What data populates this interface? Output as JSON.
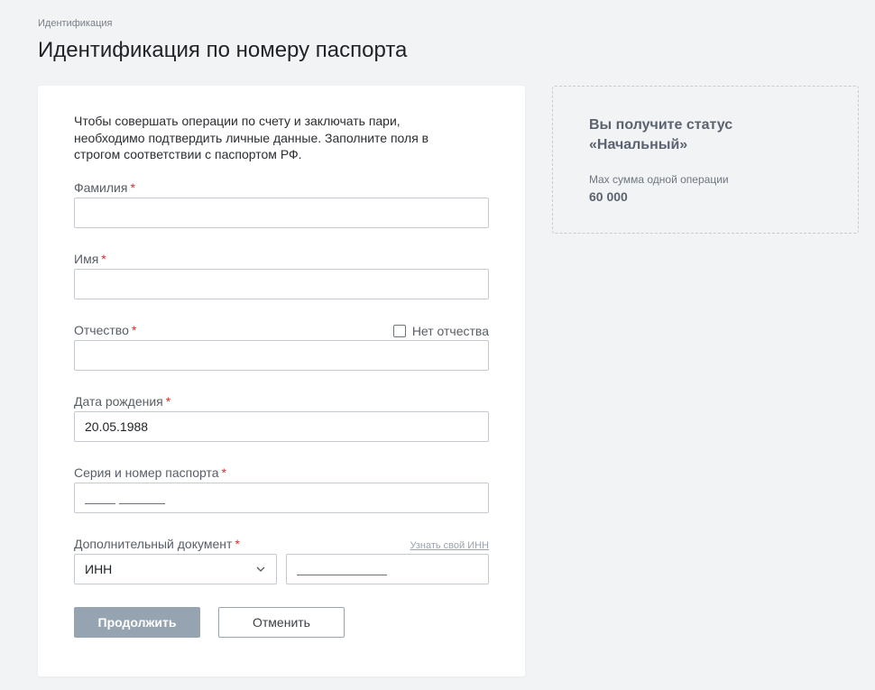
{
  "breadcrumb": "Идентификация",
  "title": "Идентификация по номеру паспорта",
  "intro": "Чтобы совершать операции по счету и заключать пари, необходимо подтвердить личные данные. Заполните поля в строгом соответствии с паспортом РФ.",
  "required_mark": "*",
  "fields": {
    "surname": {
      "label": "Фамилия",
      "value": ""
    },
    "name": {
      "label": "Имя",
      "value": ""
    },
    "patronymic": {
      "label": "Отчество",
      "value": "",
      "no_patronymic_label": "Нет отчества",
      "no_patronymic_checked": false
    },
    "birth_date": {
      "label": "Дата рождения",
      "value": "20.05.1988"
    },
    "passport": {
      "label": "Серия и номер паспорта",
      "value": ""
    },
    "extra_doc": {
      "label": "Дополнительный документ",
      "link": "Узнать свой ИНН",
      "selected": "ИНН",
      "value": ""
    }
  },
  "buttons": {
    "continue": "Продолжить",
    "cancel": "Отменить"
  },
  "status": {
    "title": "Вы получите статус «Начальный»",
    "max_label": "Max сумма одной операции",
    "max_value": "60 000"
  },
  "colors": {
    "primary_disabled": "#96a3b1",
    "required": "#d0312d",
    "background": "#f2f3f5"
  },
  "icons": {
    "select_arrow": "chevron-down-icon",
    "checkbox": "checkbox-icon"
  }
}
